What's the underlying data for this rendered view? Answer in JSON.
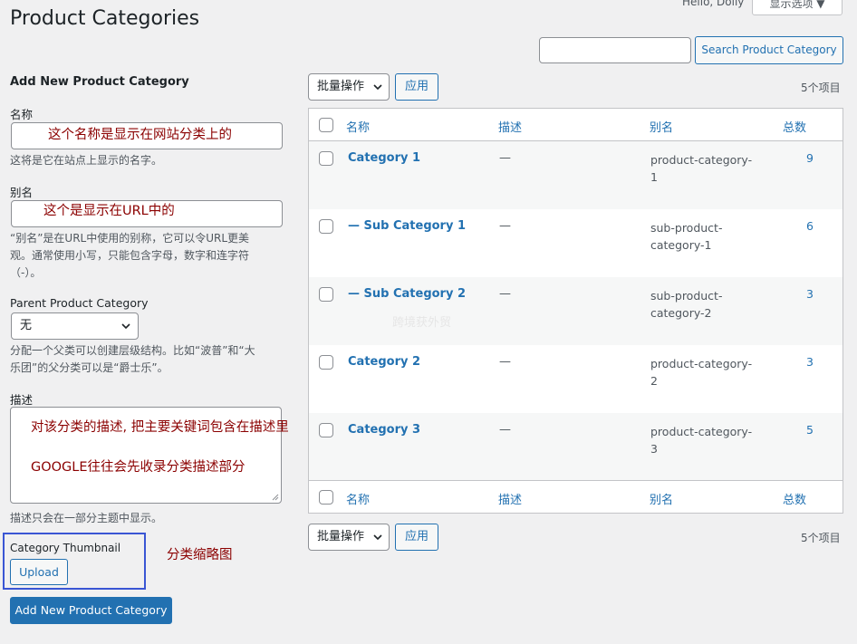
{
  "header": {
    "title": "Product Categories",
    "user_greeting": "Hello, Dolly",
    "screen_options": "显示选项 ▼"
  },
  "search": {
    "value": "",
    "button_label": "Search Product Category"
  },
  "form": {
    "heading": "Add New Product Category",
    "name_label": "名称",
    "name_annotation": "这个名称是显示在网站分类上的",
    "name_hint": "这将是它在站点上显示的名字。",
    "slug_label": "别名",
    "slug_annotation": "这个是显示在URL中的",
    "slug_hint_1": "“别名”是在URL中使用的别称，它可以令URL更美",
    "slug_hint_2": "观。通常使用小写，只能包含字母，数字和连字符",
    "slug_hint_3": "（-）。",
    "parent_label": "Parent Product Category",
    "parent_value": "无",
    "parent_hint_1": "分配一个父类可以创建层级结构。比如“波普”和“大",
    "parent_hint_2": "乐团”的父分类可以是“爵士乐”。",
    "desc_label": "描述",
    "desc_annotation_1": "对该分类的描述, 把主要关键词包含在描述里",
    "desc_annotation_2": "GOOGLE往往会先收录分类描述部分",
    "desc_hint": "描述只会在一部分主题中显示。",
    "thumb_label": "Category Thumbnail",
    "thumb_annotation": "分类缩略图",
    "upload_label": "Upload",
    "submit_label": "Add New Product Category"
  },
  "table": {
    "bulk_action": "批量操作",
    "apply_label": "应用",
    "item_count": "5个项目",
    "columns": [
      "名称",
      "描述",
      "别名",
      "总数"
    ],
    "rows": [
      {
        "name": "Category 1",
        "desc": "—",
        "slug": "product-category-1",
        "count": "9"
      },
      {
        "name": "— Sub Category 1",
        "desc": "—",
        "slug": "sub-product-category-1",
        "count": "6"
      },
      {
        "name": "— Sub Category 2",
        "desc": "—",
        "slug": "sub-product-category-2",
        "count": "3"
      },
      {
        "name": "Category 2",
        "desc": "—",
        "slug": "product-category-2",
        "count": "3"
      },
      {
        "name": "Category 3",
        "desc": "—",
        "slug": "product-category-3",
        "count": "5"
      }
    ],
    "watermark": "跨境获外贸"
  },
  "colors": {
    "accent": "#2271b1",
    "annotation": "#8b0000",
    "highlight_box": "#3a56d4"
  }
}
